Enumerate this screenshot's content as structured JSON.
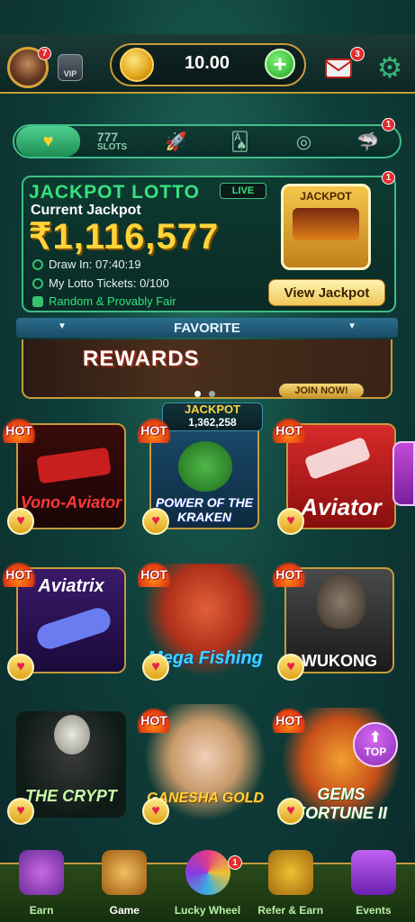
{
  "header": {
    "avatar_badge": "7",
    "vip_label": "VIP",
    "balance": "10.00",
    "add_label": "+",
    "mail_badge": "3"
  },
  "tabs": [
    {
      "name": "favorite",
      "label": "♥"
    },
    {
      "name": "slots",
      "label": "777",
      "sub": "SLOTS"
    },
    {
      "name": "crash",
      "label": "🚀"
    },
    {
      "name": "cards",
      "label": "🂡"
    },
    {
      "name": "roulette",
      "label": "◎"
    },
    {
      "name": "fishing",
      "label": "🦈"
    }
  ],
  "tabs_badge": "1",
  "jackpot": {
    "title": "JACKPOT LOTTO",
    "live": "LIVE",
    "current_label": "Current Jackpot",
    "amount": "₹1,116,577",
    "draw_label": "Draw In: 07:40:19",
    "tickets_label": "My Lotto Tickets: 0/100",
    "fair_label": "Random & Provably Fair",
    "machine_label": "JACKPOT",
    "view_button": "View Jackpot",
    "badge": "1"
  },
  "favorite_label": "FAVORITE",
  "banner": {
    "title": "REWARDS",
    "join": "JOIN NOW!"
  },
  "games": [
    {
      "title": "Vono-Aviator",
      "hot": "HOT"
    },
    {
      "title": "POWER OF THE KRAKEN",
      "hot": "HOT",
      "jackpot_label": "JACKPOT",
      "jackpot_value": "1,362,258"
    },
    {
      "title": "Aviator",
      "hot": "HOT"
    },
    {
      "title": "Aviatrix",
      "hot": "HOT"
    },
    {
      "title": "Mega Fishing",
      "hot": "HOT"
    },
    {
      "title": "WUKONG",
      "hot": "HOT"
    },
    {
      "title": "THE CRYPT",
      "hot": ""
    },
    {
      "title": "GANESHA GOLD",
      "hot": "HOT"
    },
    {
      "title": "GEMS FORTUNE II",
      "hot": "HOT"
    }
  ],
  "top_button": "TOP",
  "nav": [
    {
      "label": "Earn"
    },
    {
      "label": "Game"
    },
    {
      "label": "Lucky Wheel",
      "badge": "1"
    },
    {
      "label": "Refer & Earn"
    },
    {
      "label": "Events"
    }
  ],
  "colors": {
    "accent_gold": "#c59b3a",
    "accent_green": "#35e27d",
    "jackpot_yellow": "#ffd43a"
  }
}
